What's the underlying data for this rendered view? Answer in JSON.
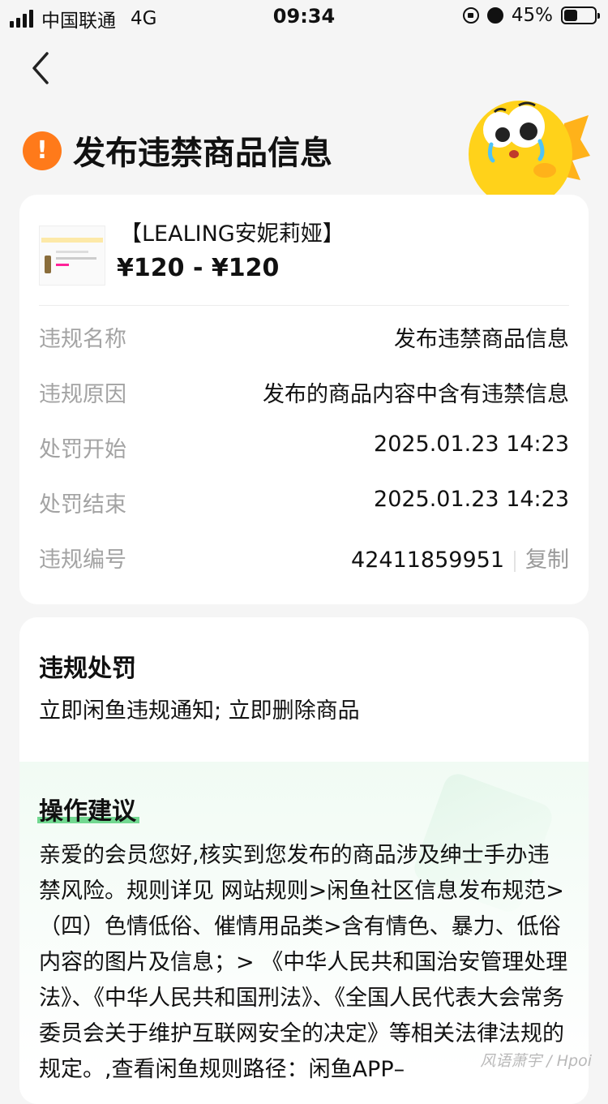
{
  "status_bar": {
    "carrier": "中国联通",
    "network": "4G",
    "time": "09:34",
    "battery": "45%",
    "battery_level": 0.45
  },
  "header": {
    "back_icon": "chevron-left-icon",
    "title": "发布违禁商品信息",
    "alert_icon": "!"
  },
  "product": {
    "name": "【LEALING安妮莉娅】",
    "price": "¥120 - ¥120"
  },
  "details": [
    {
      "label": "违规名称",
      "value": "发布违禁商品信息"
    },
    {
      "label": "违规原因",
      "value": "发布的商品内容中含有违禁信息"
    },
    {
      "label": "处罚开始",
      "value": "2025.01.23 14:23"
    },
    {
      "label": "处罚结束",
      "value": "2025.01.23 14:23"
    },
    {
      "label": "违规编号",
      "value": "42411859951",
      "action": "复制"
    }
  ],
  "penalty": {
    "title": "违规处罚",
    "text": "立即闲鱼违规通知; 立即删除商品"
  },
  "suggestion": {
    "title": "操作建议",
    "text": "亲爱的会员您好,核实到您发布的商品涉及绅士手办违禁风险。规则详见 网站规则>闲鱼社区信息发布规范>（四）色情低俗、催情用品类>含有情色、暴力、低俗内容的图片及信息；> 《中华人民共和国治安管理处理法》、《中华人民共和国刑法》、《全国人民代表大会常务委员会关于维护互联网安全的决定》等相关法律法规的规定。,查看闲鱼规则路径：闲鱼APP–"
  },
  "watermark": "风语萧宇 / Hpoi",
  "colors": {
    "accent_orange": "#ff7a1a",
    "highlight_green": "#5ad17f"
  }
}
